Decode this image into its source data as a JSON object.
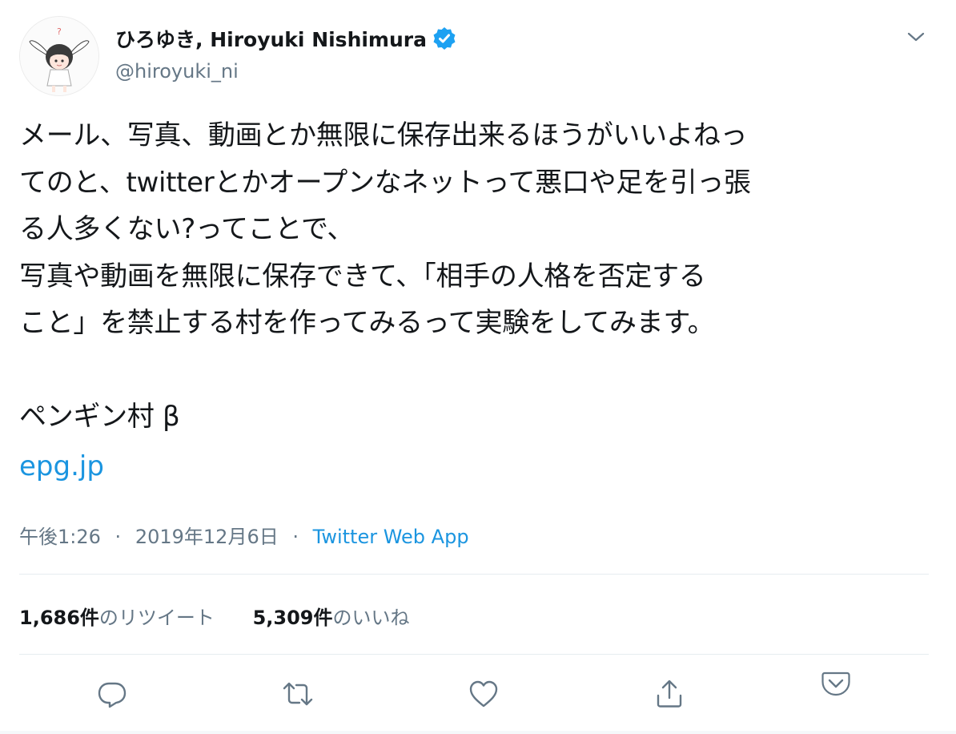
{
  "user": {
    "name": "ひろゆき, Hiroyuki Nishimura",
    "handle": "@hiroyuki_ni",
    "avatar_icon": "avatar-bunny-girl-icon",
    "verified_icon": "verified-badge-icon"
  },
  "tweet": {
    "text": "メール、写真、動画とか無限に保存出来るほうがいいよねっ\nてのと、twitterとかオープンなネットって悪口や足を引っ張\nる人多くない?ってことで、\n写真や動画を無限に保存できて、「相手の人格を否定する\nこと」を禁止する村を作ってみるって実験をしてみます。\n\nペンギン村 β",
    "link": "epg.jp"
  },
  "meta": {
    "time": "午後1:26",
    "dot1": "·",
    "date": "2019年12月6日",
    "dot2": "·",
    "app": "Twitter Web App"
  },
  "stats": {
    "retweets_count": "1,686件",
    "retweets_label": "のリツイート",
    "likes_count": "5,309件",
    "likes_label": "のいいね"
  },
  "actions": {
    "reply_icon": "reply-icon",
    "retweet_icon": "retweet-icon",
    "like_icon": "heart-icon",
    "share_icon": "share-icon",
    "pocket_icon": "pocket-icon"
  },
  "colors": {
    "text": "#14171a",
    "secondary": "#657786",
    "link": "#1b95e0",
    "verified": "#1da1f2",
    "divider": "#e6ecf0",
    "pocket": "#ef4056"
  }
}
